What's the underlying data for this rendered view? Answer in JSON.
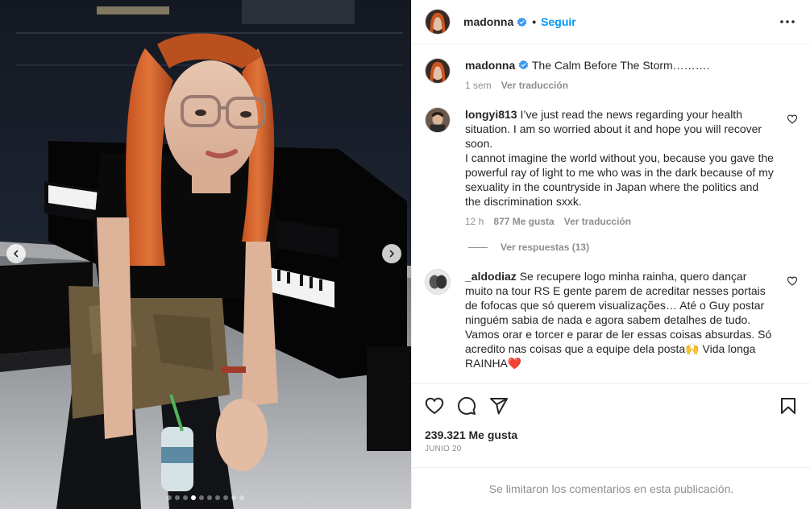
{
  "post": {
    "username": "madonna",
    "follow_label": "Seguir",
    "separator": "•",
    "caption": {
      "username": "madonna",
      "text": "The Calm Before The Storm……….",
      "time": "1 sem",
      "translate_label": "Ver traducción"
    },
    "comments": [
      {
        "username": "longyi813",
        "text": "I’ve just read the news regarding your health situation. I am so worried about it and hope you will recover soon.\nI cannot imagine the world without you, because you gave the powerful ray of light to me who was in the dark because of my sexuality in the countryside in Japan where the politics and the discrimination sxxk.",
        "time": "12 h",
        "likes": "877 Me gusta",
        "translate_label": "Ver traducción",
        "replies_label": "Ver respuestas (13)"
      },
      {
        "username": "_aldodiaz",
        "text": "Se recupere logo minha rainha, quero dançar muito na tour RS E gente parem de acreditar nesses portais de fofocas que só querem visualizações… Até o Guy postar ninguém sabia de nada e agora sabem detalhes de tudo. Vamos orar e torcer e parar de ler essas coisas absurdas. Só acredito nas coisas que a equipe dela posta🙌 Vida longa RAINHA❤️"
      }
    ],
    "likes_label": "239.321 Me gusta",
    "date": "JUNIO 20",
    "comments_limited": "Se limitaron los comentarios en esta publicación.",
    "carousel": {
      "count": 10,
      "active_index": 3
    },
    "icons": {
      "like": "heart-icon",
      "comment": "comment-icon",
      "share": "paper-plane-icon",
      "save": "bookmark-icon",
      "more": "more-dots-icon",
      "verified": "verified-badge-icon"
    },
    "colors": {
      "accent": "#0095f6",
      "verified": "#3897f0",
      "text": "#262626",
      "muted": "#8e8e8e",
      "heart_red": "#ed4956"
    }
  }
}
